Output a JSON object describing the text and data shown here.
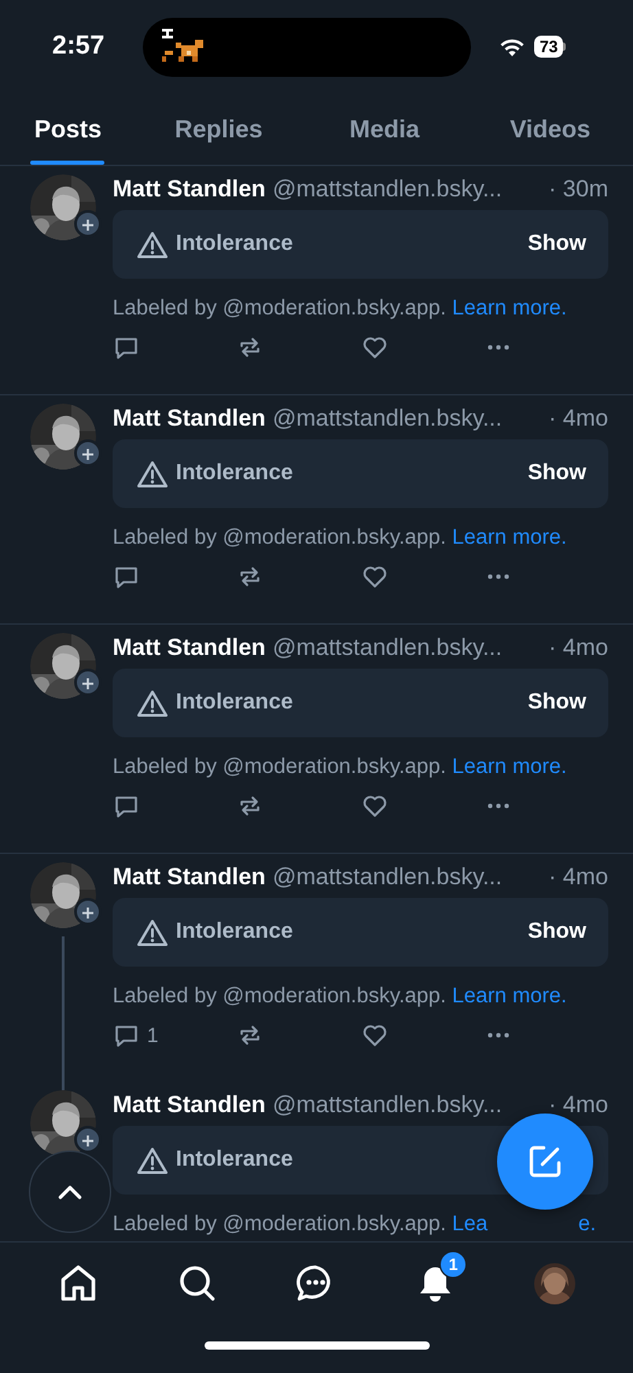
{
  "status_bar": {
    "time": "2:57",
    "battery": "73"
  },
  "tabs": [
    {
      "label": "Posts",
      "selected": true
    },
    {
      "label": "Replies",
      "selected": false
    },
    {
      "label": "Media",
      "selected": false
    },
    {
      "label": "Videos",
      "selected": false
    }
  ],
  "posts": [
    {
      "author": "Matt Standlen",
      "handle": "@mattstandlen.bsky...",
      "time": "· 30m",
      "label": "Intolerance",
      "show": "Show",
      "labeled_by": "Labeled by @moderation.bsky.app.",
      "learn_more": "Learn more.",
      "thread_continues": false,
      "actions": true
    },
    {
      "author": "Matt Standlen",
      "handle": "@mattstandlen.bsky...",
      "time": "· 4mo",
      "label": "Intolerance",
      "show": "Show",
      "labeled_by": "Labeled by @moderation.bsky.app.",
      "learn_more": "Learn more.",
      "thread_continues": false,
      "actions": true
    },
    {
      "author": "Matt Standlen",
      "handle": "@mattstandlen.bsky...",
      "time": "· 4mo",
      "label": "Intolerance",
      "show": "Show",
      "labeled_by": "Labeled by @moderation.bsky.app.",
      "learn_more": "Learn more.",
      "thread_continues": false,
      "actions": true
    },
    {
      "author": "Matt Standlen",
      "handle": "@mattstandlen.bsky...",
      "time": "· 4mo",
      "label": "Intolerance",
      "show": "Show",
      "labeled_by": "Labeled by @moderation.bsky.app.",
      "learn_more": "Learn more.",
      "reply_count": "1",
      "thread_continues": true,
      "actions": true
    },
    {
      "author": "Matt Standlen",
      "handle": "@mattstandlen.bsky...",
      "time": "· 4mo",
      "label": "Intolerance",
      "labeled_by": "Labeled by @moderation.bsky.app.",
      "learn_more_parts": [
        "Lea",
        "e."
      ],
      "thread_continues": false,
      "actions": false
    }
  ],
  "bottom_nav": [
    {
      "kind": "home"
    },
    {
      "kind": "search"
    },
    {
      "kind": "chat"
    },
    {
      "kind": "bell",
      "badge": "1"
    },
    {
      "kind": "profile"
    }
  ]
}
